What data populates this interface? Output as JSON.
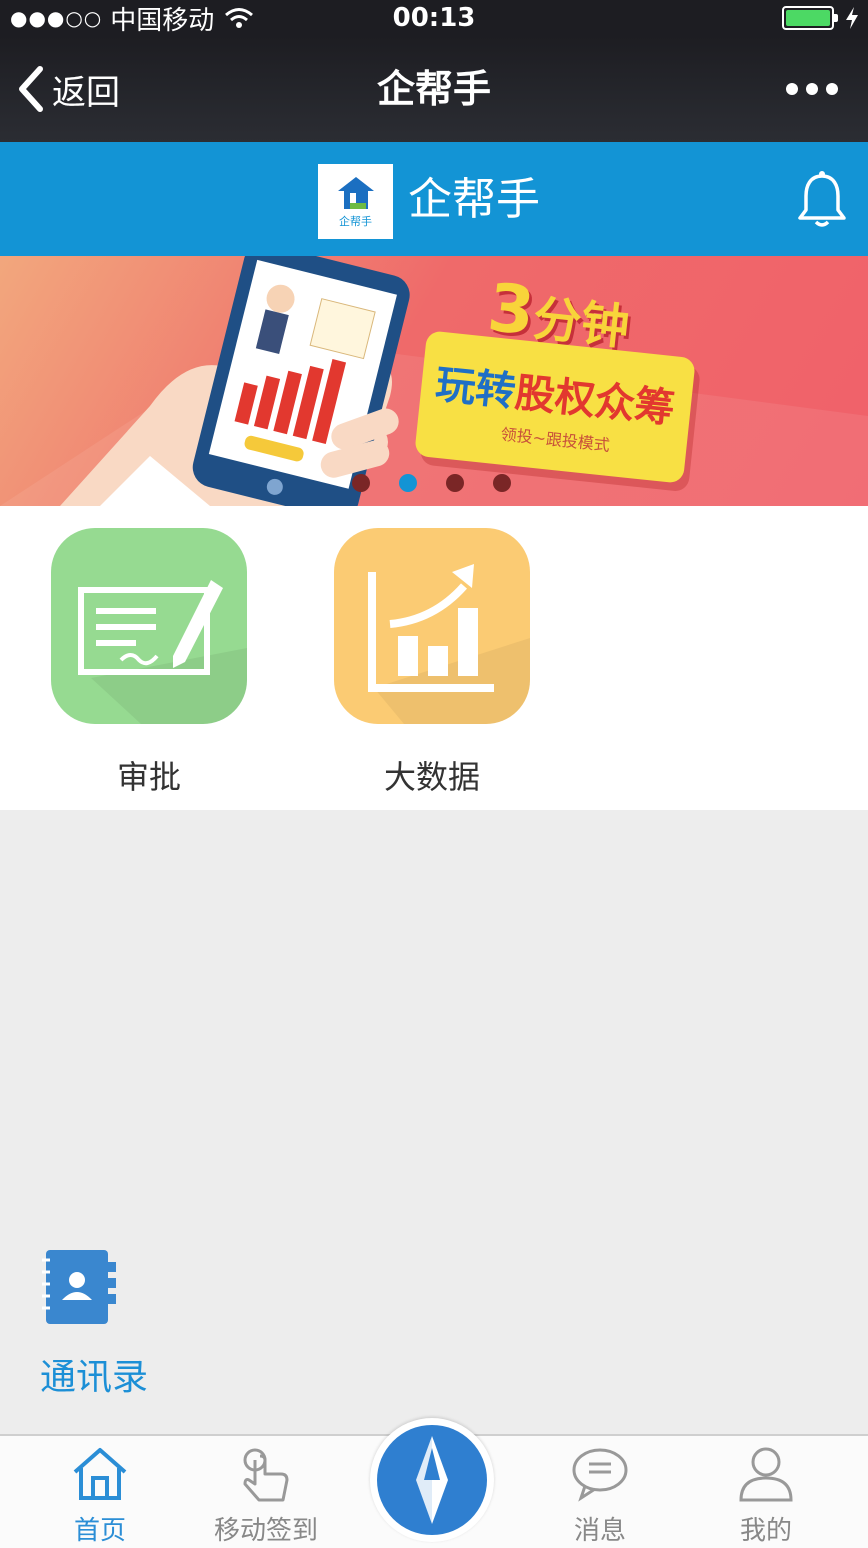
{
  "status_bar": {
    "signal": "●●●○○",
    "carrier": "中国移动",
    "time": "00:13"
  },
  "nav": {
    "back_label": "返回",
    "title": "企帮手"
  },
  "app_header": {
    "logo_text": "企帮手",
    "name": "企帮手"
  },
  "banner": {
    "headline_number": "3",
    "headline_text": "分钟",
    "card_title_a": "玩转",
    "card_title_b": "股权众筹",
    "card_sub": "领投~跟投模式",
    "page_count": 4,
    "active_page": 2
  },
  "apps": [
    {
      "label": "审批",
      "icon": "approval-icon",
      "color": "#8fd68c"
    },
    {
      "label": "大数据",
      "icon": "big-data-chart-icon",
      "color": "#f9c76f"
    }
  ],
  "contacts": {
    "label": "通讯录",
    "icon": "address-book-icon"
  },
  "tabbar": {
    "items": [
      {
        "label": "首页",
        "icon": "home-icon",
        "active": true
      },
      {
        "label": "移动签到",
        "icon": "tap-hand-icon",
        "active": false
      },
      {
        "label": "消息",
        "icon": "chat-bubble-icon",
        "active": false
      },
      {
        "label": "我的",
        "icon": "user-icon",
        "active": false
      }
    ],
    "center_icon": "compass-icon"
  },
  "colors": {
    "accent": "#1394d5",
    "nav_bg": "#1d1d22",
    "tab_active": "#2b8ed6"
  }
}
